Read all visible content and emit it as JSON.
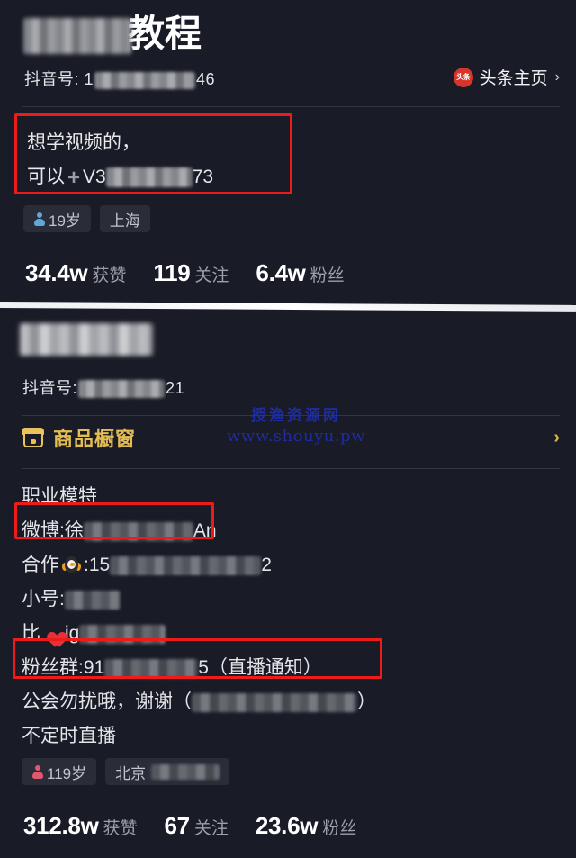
{
  "meta": {
    "background_color": "#191b26",
    "accent_gold": "#e3bd52",
    "accent_red": "#ee1b1b",
    "toutiao_red": "#d8352a"
  },
  "profile_1": {
    "nickname_suffix": "教程",
    "douyin_id_label": "抖音号: 1",
    "douyin_id_tail": "46",
    "toutiao": {
      "badge_text": "头条",
      "label": "头条主页",
      "chevron": "›"
    },
    "bio": {
      "line1": "想学视频的，",
      "line2_prefix": "可以",
      "line2_plus": "➕",
      "line2_mid": "V3",
      "line2_tail": "73"
    },
    "tags": [
      {
        "icon": "person-icon",
        "gender": "male",
        "label": "19岁"
      },
      {
        "icon": "",
        "gender": "",
        "label": "上海"
      }
    ],
    "stats": [
      {
        "num": "34.4w",
        "label": "获赞"
      },
      {
        "num": "119",
        "label": "关注"
      },
      {
        "num": "6.4w",
        "label": "粉丝"
      }
    ]
  },
  "profile_2": {
    "douyin_id_label": "抖音号:",
    "douyin_id_tail": "21",
    "shop": {
      "label": "商品橱窗",
      "chevron": "›"
    },
    "bio": {
      "line1": "职业模特",
      "line2_prefix": "微博:徐",
      "line2_tail": "An",
      "line3_prefix": "合作",
      "line3_mid": ":15",
      "line3_tail": "2",
      "line4_prefix": "小号:",
      "line5_prefix": "比",
      "line5_mid": "ig",
      "line6_prefix": "粉丝群:91",
      "line6_mid": "5",
      "line6_tail": "（直播通知）",
      "line7_prefix": "公会勿扰哦，谢谢（",
      "line7_tail": "）",
      "line8": "不定时直播"
    },
    "tags": [
      {
        "icon": "person-icon",
        "gender": "female",
        "label": "119岁"
      },
      {
        "icon": "",
        "gender": "",
        "label": "北京"
      }
    ],
    "stats": [
      {
        "num": "312.8w",
        "label": "获赞"
      },
      {
        "num": "67",
        "label": "关注"
      },
      {
        "num": "23.6w",
        "label": "粉丝"
      }
    ]
  },
  "watermark": {
    "cn": "授渔资源网",
    "url": "www.shouyu.pw"
  }
}
